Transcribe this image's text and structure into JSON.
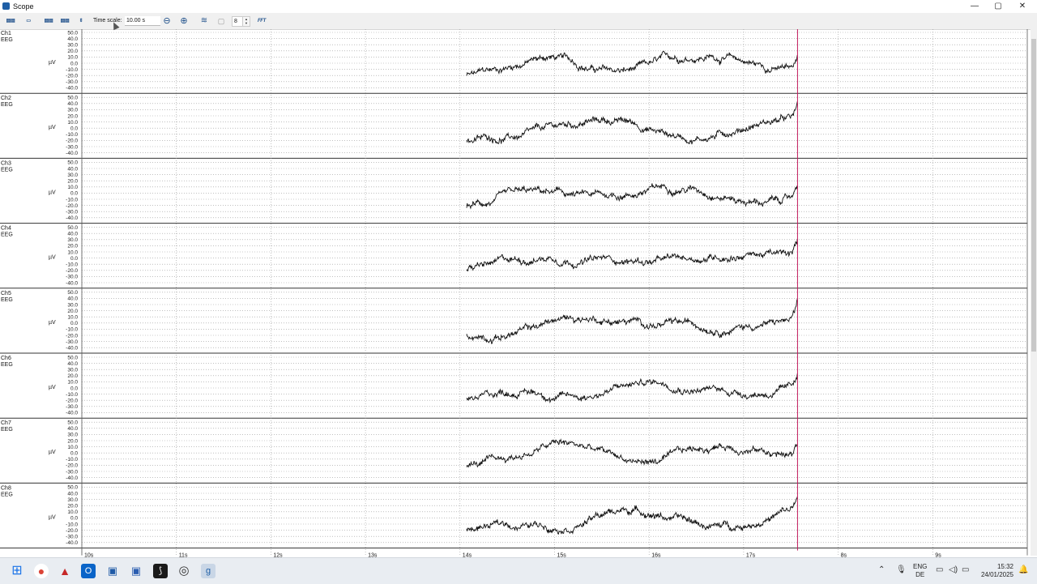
{
  "window": {
    "title": "Scope",
    "minimize": "—",
    "maximize": "▢",
    "close": "✕"
  },
  "toolbar": {
    "time_scale_label": "Time scale:",
    "time_scale_value": "10.00 s",
    "channel_count": "8",
    "fft_label": "FFT",
    "buttons": [
      "▤▤",
      "▭",
      "▤▤",
      "▤▤",
      "⇕",
      "⊖",
      "⊕",
      "≋",
      "▢"
    ]
  },
  "channels": [
    {
      "name": "Ch1",
      "type": "EEG",
      "unit": "µV"
    },
    {
      "name": "Ch2",
      "type": "EEG",
      "unit": "µV"
    },
    {
      "name": "Ch3",
      "type": "EEG",
      "unit": "µV"
    },
    {
      "name": "Ch4",
      "type": "EEG",
      "unit": "µV"
    },
    {
      "name": "Ch5",
      "type": "EEG",
      "unit": "µV"
    },
    {
      "name": "Ch6",
      "type": "EEG",
      "unit": "µV"
    },
    {
      "name": "Ch7",
      "type": "EEG",
      "unit": "µV"
    },
    {
      "name": "Ch8",
      "type": "EEG",
      "unit": "µV"
    }
  ],
  "y_ticks": [
    "50.0",
    "40.0",
    "30.0",
    "20.0",
    "10.0",
    "0.0",
    "-10.0",
    "-20.0",
    "-30.0",
    "-40.0"
  ],
  "time_axis": {
    "labels": [
      "10s",
      "11s",
      "12s",
      "13s",
      "14s",
      "15s",
      "16s",
      "17s",
      "8s",
      "9s"
    ]
  },
  "chart_data": {
    "type": "line",
    "ylim": [
      -45,
      50
    ],
    "time_labels": [
      "10s",
      "11s",
      "12s",
      "13s",
      "14s",
      "15s",
      "16s",
      "17s",
      "8s",
      "9s"
    ],
    "signal_start": "14s",
    "cursor_label": "17s",
    "colors": {
      "signal": "#111111",
      "cursor": "#c2185b",
      "grid": "#9a9a9a"
    }
  },
  "taskbar": {
    "lang": "ENG",
    "region": "DE",
    "time": "15:32",
    "date": "24/01/2025",
    "apps": [
      "start-icon",
      "chrome-icon",
      "pdf-icon",
      "outlook-icon",
      "camera-icon",
      "teams-icon",
      "terminal-icon",
      "recorder-icon",
      "g-app-icon"
    ]
  }
}
